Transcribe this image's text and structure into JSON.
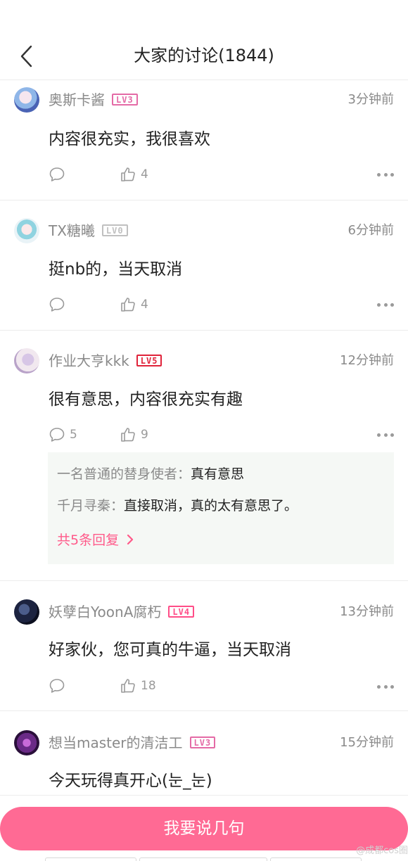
{
  "header": {
    "title": "大家的讨论(1844)"
  },
  "comments": [
    {
      "username": "奥斯卡酱",
      "level": "LV3",
      "level_color": "#e46aa6",
      "time": "3分钟前",
      "content": "内容很充实，我很喜欢",
      "reply_count": "",
      "like_count": "4"
    },
    {
      "username": "TX糖曦",
      "level": "LV0",
      "level_color": "#c0c0c0",
      "time": "6分钟前",
      "content": "挺nb的，当天取消",
      "reply_count": "",
      "like_count": "4"
    },
    {
      "username": "作业大亨kkk",
      "level": "LV5",
      "level_color": "#e0233a",
      "time": "12分钟前",
      "content": "很有意思，内容很充实有趣",
      "reply_count": "5",
      "like_count": "9",
      "replies": [
        {
          "name": "一名普通的替身使者：",
          "text": "真有意思"
        },
        {
          "name": "千月寻秦：",
          "text": "直接取消，真的太有意思了。"
        }
      ],
      "more_replies": "共5条回复"
    },
    {
      "username": "妖孽白YoonA腐朽",
      "level": "LV4",
      "level_color": "#ff4d88",
      "time": "13分钟前",
      "content": "好家伙，您可真的牛逼，当天取消",
      "reply_count": "",
      "like_count": "18"
    },
    {
      "username": "想当master的清洁工",
      "level": "LV3",
      "level_color": "#e46aa6",
      "time": "15分钟前",
      "content": "今天玩得真开心(눈_눈)"
    }
  ],
  "bottom": {
    "say_button": "我要说几句",
    "watermark": "@成都cos圈"
  },
  "colors": {
    "accent": "#ff6a94",
    "link": "#ff5a8a"
  },
  "icons": [
    "back-icon",
    "comment-icon",
    "like-icon",
    "more-icon",
    "chevron-right-icon"
  ]
}
